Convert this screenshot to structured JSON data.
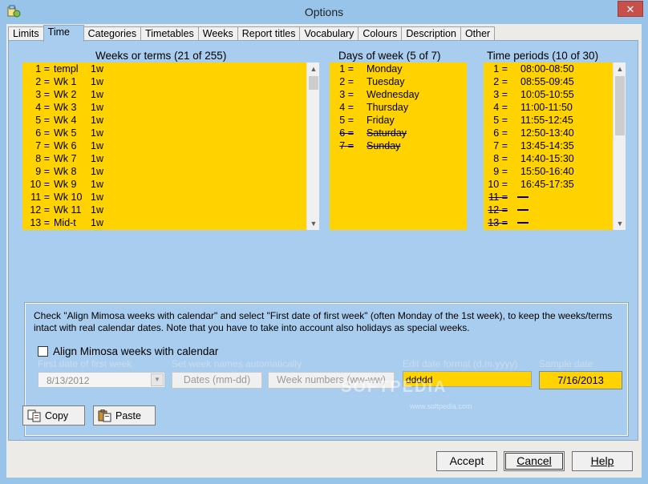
{
  "window": {
    "title": "Options",
    "close_glyph": "✕"
  },
  "tabs": [
    {
      "label": "Limits",
      "active": false
    },
    {
      "label": "Time",
      "active": true
    },
    {
      "label": "Categories",
      "active": false
    },
    {
      "label": "Timetables",
      "active": false
    },
    {
      "label": "Weeks",
      "active": false
    },
    {
      "label": "Report titles",
      "active": false
    },
    {
      "label": "Vocabulary",
      "active": false
    },
    {
      "label": "Colours",
      "active": false
    },
    {
      "label": "Description",
      "active": false
    },
    {
      "label": "Other",
      "active": false
    }
  ],
  "weeks": {
    "header": "Weeks or terms (21 of 255)",
    "rows": [
      {
        "num": "1 =",
        "name": "templ",
        "len": "1w"
      },
      {
        "num": "2 =",
        "name": "Wk 1",
        "len": "1w"
      },
      {
        "num": "3 =",
        "name": "Wk 2",
        "len": "1w"
      },
      {
        "num": "4 =",
        "name": "Wk 3",
        "len": "1w"
      },
      {
        "num": "5 =",
        "name": "Wk 4",
        "len": "1w"
      },
      {
        "num": "6 =",
        "name": "Wk 5",
        "len": "1w"
      },
      {
        "num": "7 =",
        "name": "Wk 6",
        "len": "1w"
      },
      {
        "num": "8 =",
        "name": "Wk 7",
        "len": "1w"
      },
      {
        "num": "9 =",
        "name": "Wk 8",
        "len": "1w"
      },
      {
        "num": "10 =",
        "name": "Wk 9",
        "len": "1w"
      },
      {
        "num": "11 =",
        "name": "Wk 10",
        "len": "1w"
      },
      {
        "num": "12 =",
        "name": "Wk 11",
        "len": "1w"
      },
      {
        "num": "13 =",
        "name": "Mid-t",
        "len": "1w"
      }
    ]
  },
  "days": {
    "header": "Days of week (5 of 7)",
    "rows": [
      {
        "num": "1 =",
        "name": "Monday",
        "disabled": false
      },
      {
        "num": "2 =",
        "name": "Tuesday",
        "disabled": false
      },
      {
        "num": "3 =",
        "name": "Wednesday",
        "disabled": false
      },
      {
        "num": "4 =",
        "name": "Thursday",
        "disabled": false
      },
      {
        "num": "5 =",
        "name": "Friday",
        "disabled": false
      },
      {
        "num": "6 =",
        "name": "Saturday",
        "disabled": true
      },
      {
        "num": "7 =",
        "name": "Sunday",
        "disabled": true
      }
    ]
  },
  "periods": {
    "header": "Time periods (10 of 30)",
    "rows": [
      {
        "num": "1 =",
        "name": "08:00-08:50",
        "disabled": false
      },
      {
        "num": "2 =",
        "name": "08:55-09:45",
        "disabled": false
      },
      {
        "num": "3 =",
        "name": "10:05-10:55",
        "disabled": false
      },
      {
        "num": "4 =",
        "name": "11:00-11:50",
        "disabled": false
      },
      {
        "num": "5 =",
        "name": "11:55-12:45",
        "disabled": false
      },
      {
        "num": "6 =",
        "name": "12:50-13:40",
        "disabled": false
      },
      {
        "num": "7 =",
        "name": "13:45-14:35",
        "disabled": false
      },
      {
        "num": "8 =",
        "name": "14:40-15:30",
        "disabled": false
      },
      {
        "num": "9 =",
        "name": "15:50-16:40",
        "disabled": false
      },
      {
        "num": "10 =",
        "name": "16:45-17:35",
        "disabled": false
      },
      {
        "num": "11 =",
        "name": "",
        "disabled": true
      },
      {
        "num": "12 =",
        "name": "",
        "disabled": true
      },
      {
        "num": "13 =",
        "name": "",
        "disabled": true
      }
    ]
  },
  "calendar": {
    "info_text": "Check \"Align Mimosa weeks with calendar\" and select  \"First date of first week\" (often Monday of the 1st week), to keep the weeks/terms intact with real calendar dates. Note that you have to take into account also holidays as special weeks.",
    "align_label": "Align Mimosa weeks with calendar",
    "align_checked": false,
    "first_date_label": "First date of first week",
    "first_date_value": "8/13/2012",
    "auto_names_label": "Set week names automatically",
    "dates_button": "Dates (mm-dd)",
    "numbers_button": "Week numbers (ww-ww)",
    "format_label": "Edit date format (d.m.yyyy)",
    "format_value": "ddddd",
    "sample_label": "Sample date",
    "sample_value": "7/16/2013"
  },
  "watermark": {
    "text": "SOFTPEDIA",
    "url": "www.softpedia.com"
  },
  "buttons": {
    "copy": "Copy",
    "paste": "Paste",
    "accept": "Accept",
    "cancel": "Cancel",
    "help": "Help"
  },
  "colors": {
    "list_background": "#ffd200",
    "panel_background": "#a9cdee",
    "window_frame": "#99c4ea",
    "close_button": "#c7504a"
  },
  "icons": [
    "app-icon",
    "close-icon",
    "scroll-up-icon",
    "scroll-down-icon",
    "copy-icon",
    "paste-icon",
    "dropdown-icon"
  ]
}
